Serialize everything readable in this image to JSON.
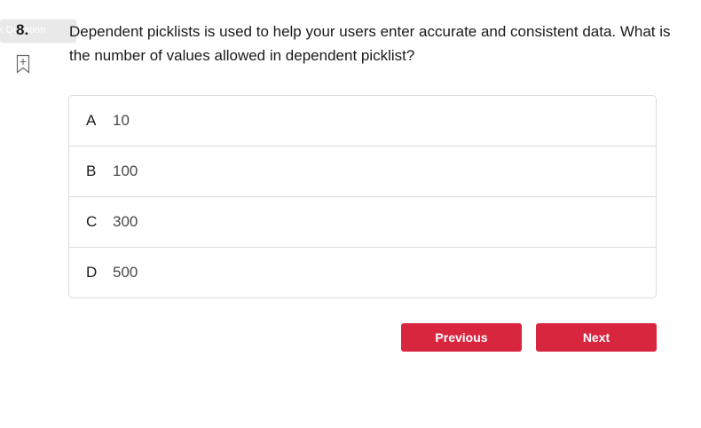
{
  "tooltip": {
    "text": "rk Question"
  },
  "question": {
    "number": "8.",
    "text": "Dependent picklists is used to help your users enter accurate and consistent data. What is the number of values allowed in dependent picklist?"
  },
  "bookmark": {
    "icon": "bookmark-add-icon"
  },
  "options": [
    {
      "letter": "A",
      "text": "10"
    },
    {
      "letter": "B",
      "text": "100"
    },
    {
      "letter": "C",
      "text": "300"
    },
    {
      "letter": "D",
      "text": "500"
    }
  ],
  "nav": {
    "previous_label": "Previous",
    "next_label": "Next"
  },
  "colors": {
    "accent": "#d9263f",
    "border": "#dcdcdc",
    "tooltip_bg": "#e9e9e9"
  }
}
